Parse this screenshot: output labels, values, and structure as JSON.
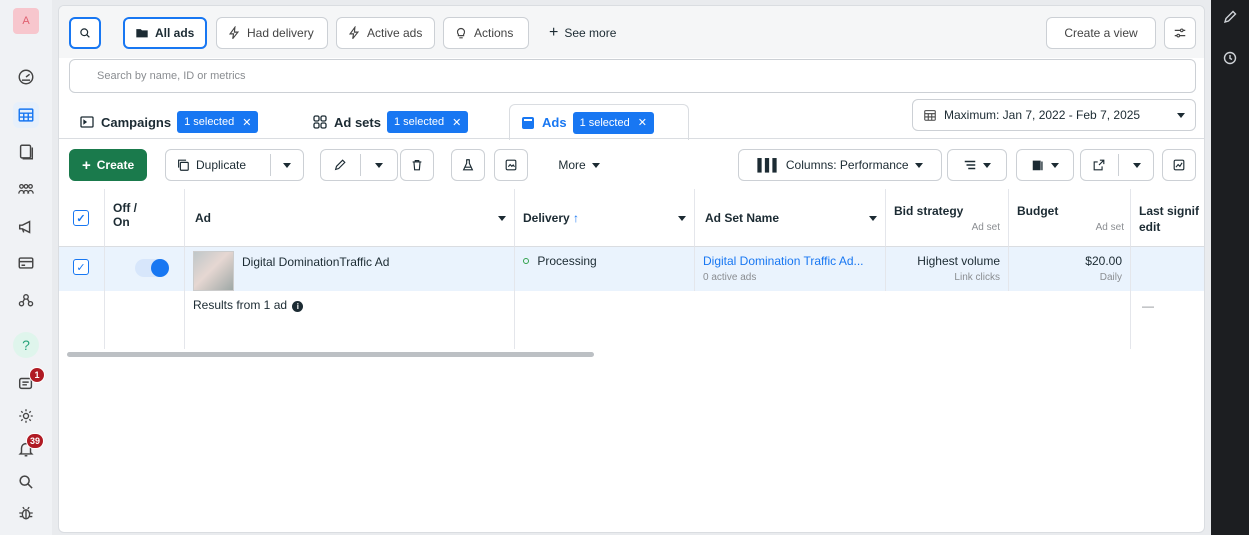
{
  "avatar_letter": "A",
  "left_nav": {
    "icons": [
      "dashboard-icon",
      "table-icon",
      "pages-icon",
      "audience-icon",
      "megaphone-icon",
      "billing-icon",
      "people-icon",
      "help-icon",
      "notifications-icon",
      "settings-icon",
      "alerts-icon",
      "search-icon",
      "bug-icon"
    ],
    "help_label": "?",
    "notifications_badge": "1",
    "alerts_badge": "39"
  },
  "filters": {
    "all_ads": "All ads",
    "had_delivery": "Had delivery",
    "active_ads": "Active ads",
    "actions": "Actions",
    "see_more": "See more",
    "create_view": "Create a view"
  },
  "search": {
    "placeholder": "Search by name, ID or metrics"
  },
  "levels": {
    "campaigns": "Campaigns",
    "ad_sets": "Ad sets",
    "ads": "Ads",
    "selected_chip": "1 selected"
  },
  "date_range": "Maximum: Jan 7, 2022 - Feb 7, 2025",
  "toolbar": {
    "create": "Create",
    "duplicate": "Duplicate",
    "more": "More",
    "columns": "Columns: Performance"
  },
  "table": {
    "headers": {
      "off_on": "Off / On",
      "ad": "Ad",
      "delivery": "Delivery",
      "delivery_arrow": "↑",
      "ad_set_name": "Ad Set Name",
      "bid_strategy": "Bid strategy",
      "bid_strategy_sub": "Ad set",
      "budget": "Budget",
      "budget_sub": "Ad set",
      "last_edit": "Last signif edit"
    },
    "row": {
      "ad_name": "Digital DominationTraffic Ad",
      "delivery": "Processing",
      "ad_set_name": "Digital Domination Traffic Ad...",
      "ad_set_sub": "0 active ads",
      "bid_strategy": "Highest volume",
      "bid_strategy_sub": "Link clicks",
      "budget": "$20.00",
      "budget_sub": "Daily"
    },
    "results_text": "Results from 1 ad",
    "last_edit_total": "—"
  },
  "colors": {
    "accent": "#1877f2",
    "create_button": "#1a7a4c",
    "delivery_dot": "#31a24c",
    "badge": "#b01b24"
  }
}
